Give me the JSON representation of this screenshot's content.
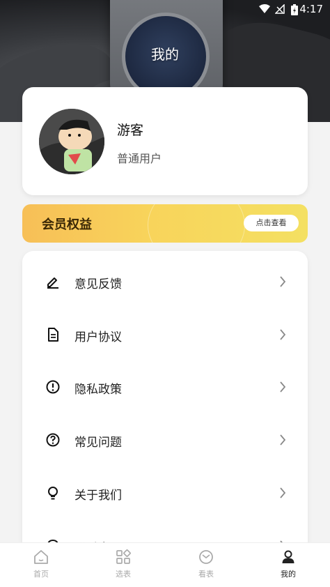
{
  "status": {
    "time": "4:17"
  },
  "header": {
    "title": "我的"
  },
  "profile": {
    "name": "游客",
    "role": "普通用户"
  },
  "member": {
    "title": "会员权益",
    "button": "点击查看"
  },
  "menu": [
    {
      "label": "意见反馈",
      "icon": "pencil-icon"
    },
    {
      "label": "用户协议",
      "icon": "document-icon"
    },
    {
      "label": "隐私政策",
      "icon": "info-circle-icon"
    },
    {
      "label": "常见问题",
      "icon": "question-circle-icon"
    },
    {
      "label": "关于我们",
      "icon": "bulb-icon"
    },
    {
      "label": "联系客服",
      "icon": "headset-icon"
    }
  ],
  "tabs": [
    {
      "label": "首页",
      "icon": "home-icon",
      "active": false
    },
    {
      "label": "选表",
      "icon": "grid-icon",
      "active": false
    },
    {
      "label": "看表",
      "icon": "watch-icon",
      "active": false
    },
    {
      "label": "我的",
      "icon": "user-icon",
      "active": true
    }
  ]
}
